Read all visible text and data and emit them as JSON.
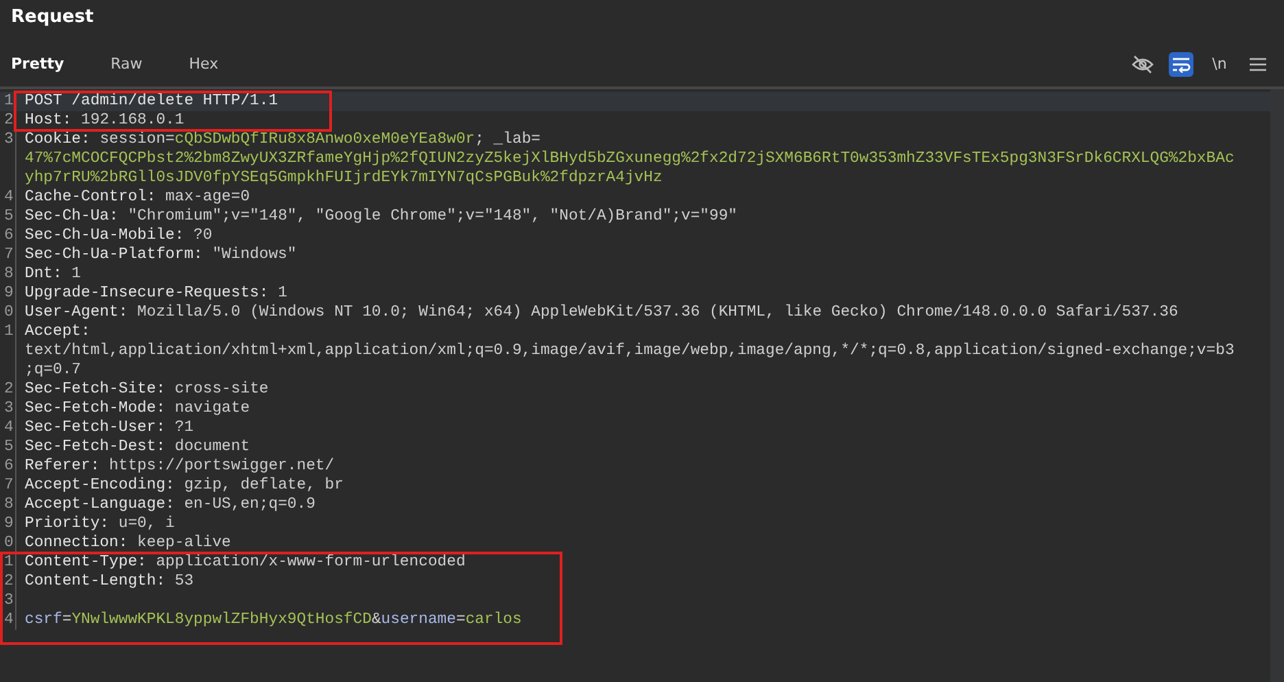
{
  "panel": {
    "title": "Request"
  },
  "tabs": [
    {
      "label": "Pretty",
      "selected": true
    },
    {
      "label": "Raw",
      "selected": false
    },
    {
      "label": "Hex",
      "selected": false
    }
  ],
  "toolbar": [
    {
      "kind": "hide",
      "selected": false
    },
    {
      "kind": "wrap",
      "selected": true
    },
    {
      "kind": "newline",
      "label": "\\n",
      "selected": false
    },
    {
      "kind": "menu",
      "selected": false
    }
  ],
  "lines": [
    {
      "number": "1",
      "current": true,
      "boxed": true,
      "rows": [
        [
          {
            "kind": "name",
            "text": "POST /admin/delete HTTP/1.1"
          }
        ]
      ]
    },
    {
      "number": "2",
      "current": false,
      "boxed": true,
      "rows": [
        [
          {
            "kind": "name",
            "text": "Host:"
          },
          {
            "kind": "text",
            "text": " 192.168.0.1"
          }
        ]
      ]
    },
    {
      "number": "3",
      "current": false,
      "boxed": false,
      "rows": [
        [
          {
            "kind": "name",
            "text": "Cookie:"
          },
          {
            "kind": "text",
            "text": " session="
          },
          {
            "kind": "value",
            "text": "cQbSDwbQfIRu8x8Anwo0xeM0eYEa8w0r"
          },
          {
            "kind": "text",
            "text": "; _lab="
          }
        ],
        [
          {
            "kind": "value",
            "text": "47%7cMCOCFQCPbst2%2bm8ZwyUX3ZRfameYgHjp%2fQIUN2zyZ5kejXlBHyd5bZGxunegg%2fx2d72jSXM6B6RtT0w353mhZ33VFsTEx5pg3N3FSrDk6CRXLQG%2bxBAc"
          }
        ],
        [
          {
            "kind": "value",
            "text": "yhp7rRU%2bRGll0sJDV0fpYSEq5GmpkhFUIjrdEYk7mIYN7qCsPGBuk%2fdpzrA4jvHz"
          }
        ]
      ]
    },
    {
      "number": "4",
      "current": false,
      "boxed": false,
      "rows": [
        [
          {
            "kind": "name",
            "text": "Cache-Control:"
          },
          {
            "kind": "text",
            "text": " max-age=0"
          }
        ]
      ]
    },
    {
      "number": "5",
      "current": false,
      "boxed": false,
      "rows": [
        [
          {
            "kind": "name",
            "text": "Sec-Ch-Ua:"
          },
          {
            "kind": "text",
            "text": " \"Chromium\";v=\"148\", \"Google Chrome\";v=\"148\", \"Not/A)Brand\";v=\"99\""
          }
        ]
      ]
    },
    {
      "number": "6",
      "current": false,
      "boxed": false,
      "rows": [
        [
          {
            "kind": "name",
            "text": "Sec-Ch-Ua-Mobile:"
          },
          {
            "kind": "text",
            "text": " ?0"
          }
        ]
      ]
    },
    {
      "number": "7",
      "current": false,
      "boxed": false,
      "rows": [
        [
          {
            "kind": "name",
            "text": "Sec-Ch-Ua-Platform:"
          },
          {
            "kind": "text",
            "text": " \"Windows\""
          }
        ]
      ]
    },
    {
      "number": "8",
      "current": false,
      "boxed": false,
      "rows": [
        [
          {
            "kind": "name",
            "text": "Dnt:"
          },
          {
            "kind": "text",
            "text": " 1"
          }
        ]
      ]
    },
    {
      "number": "9",
      "current": false,
      "boxed": false,
      "rows": [
        [
          {
            "kind": "name",
            "text": "Upgrade-Insecure-Requests:"
          },
          {
            "kind": "text",
            "text": " 1"
          }
        ]
      ]
    },
    {
      "number": "0",
      "current": false,
      "boxed": false,
      "rows": [
        [
          {
            "kind": "name",
            "text": "User-Agent:"
          },
          {
            "kind": "text",
            "text": " Mozilla/5.0 (Windows NT 10.0; Win64; x64) AppleWebKit/537.36 (KHTML, like Gecko) Chrome/148.0.0.0 Safari/537.36"
          }
        ]
      ]
    },
    {
      "number": "1",
      "current": false,
      "boxed": false,
      "rows": [
        [
          {
            "kind": "name",
            "text": "Accept:"
          }
        ],
        [
          {
            "kind": "text",
            "text": "text/html,application/xhtml+xml,application/xml;q=0.9,image/avif,image/webp,image/apng,*/*;q=0.8,application/signed-exchange;v=b3"
          }
        ],
        [
          {
            "kind": "text",
            "text": ";q=0.7"
          }
        ]
      ]
    },
    {
      "number": "2",
      "current": false,
      "boxed": false,
      "rows": [
        [
          {
            "kind": "name",
            "text": "Sec-Fetch-Site:"
          },
          {
            "kind": "text",
            "text": " cross-site"
          }
        ]
      ]
    },
    {
      "number": "3",
      "current": false,
      "boxed": false,
      "rows": [
        [
          {
            "kind": "name",
            "text": "Sec-Fetch-Mode:"
          },
          {
            "kind": "text",
            "text": " navigate"
          }
        ]
      ]
    },
    {
      "number": "4",
      "current": false,
      "boxed": false,
      "rows": [
        [
          {
            "kind": "name",
            "text": "Sec-Fetch-User:"
          },
          {
            "kind": "text",
            "text": " ?1"
          }
        ]
      ]
    },
    {
      "number": "5",
      "current": false,
      "boxed": false,
      "rows": [
        [
          {
            "kind": "name",
            "text": "Sec-Fetch-Dest:"
          },
          {
            "kind": "text",
            "text": " document"
          }
        ]
      ]
    },
    {
      "number": "6",
      "current": false,
      "boxed": false,
      "rows": [
        [
          {
            "kind": "name",
            "text": "Referer:"
          },
          {
            "kind": "text",
            "text": " https://portswigger.net/"
          }
        ]
      ]
    },
    {
      "number": "7",
      "current": false,
      "boxed": false,
      "rows": [
        [
          {
            "kind": "name",
            "text": "Accept-Encoding:"
          },
          {
            "kind": "text",
            "text": " gzip, deflate, br"
          }
        ]
      ]
    },
    {
      "number": "8",
      "current": false,
      "boxed": false,
      "rows": [
        [
          {
            "kind": "name",
            "text": "Accept-Language:"
          },
          {
            "kind": "text",
            "text": " en-US,en;q=0.9"
          }
        ]
      ]
    },
    {
      "number": "9",
      "current": false,
      "boxed": false,
      "rows": [
        [
          {
            "kind": "name",
            "text": "Priority:"
          },
          {
            "kind": "text",
            "text": " u=0, i"
          }
        ]
      ]
    },
    {
      "number": "0",
      "current": false,
      "boxed": false,
      "rows": [
        [
          {
            "kind": "name",
            "text": "Connection:"
          },
          {
            "kind": "text",
            "text": " keep-alive"
          }
        ]
      ]
    },
    {
      "number": "1",
      "current": false,
      "boxed": true,
      "rows": [
        [
          {
            "kind": "name",
            "text": "Content-Type:"
          },
          {
            "kind": "text",
            "text": " application/x-www-form-urlencoded"
          }
        ]
      ]
    },
    {
      "number": "2",
      "current": false,
      "boxed": true,
      "rows": [
        [
          {
            "kind": "name",
            "text": "Content-Length:"
          },
          {
            "kind": "text",
            "text": " 53"
          }
        ]
      ]
    },
    {
      "number": "3",
      "current": false,
      "boxed": true,
      "rows": [
        []
      ]
    },
    {
      "number": "4",
      "current": false,
      "boxed": true,
      "rows": [
        [
          {
            "kind": "param",
            "text": "csrf"
          },
          {
            "kind": "text",
            "text": "="
          },
          {
            "kind": "value",
            "text": "YNwlwwwKPKL8yppwlZFbHyx9QtHosfCD"
          },
          {
            "kind": "text",
            "text": "&"
          },
          {
            "kind": "param",
            "text": "username"
          },
          {
            "kind": "text",
            "text": "="
          },
          {
            "kind": "value",
            "text": "carlos"
          }
        ]
      ]
    }
  ]
}
